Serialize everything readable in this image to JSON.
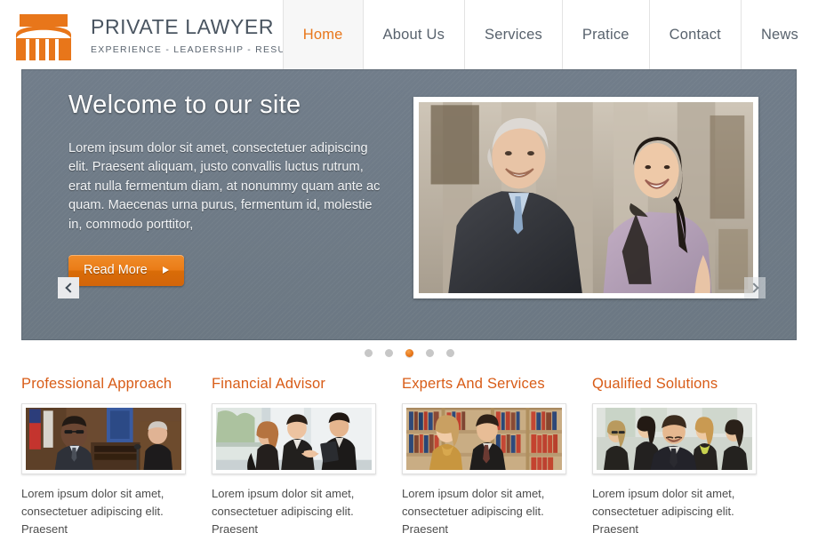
{
  "header": {
    "logo_icon": "courthouse-icon",
    "brand_title": "PRIVATE LAWYER",
    "brand_tagline": "EXPERIENCE  -  LEADERSHIP  -  RESULTS",
    "brand_color": "#e8761a",
    "title_color": "#4a5561",
    "nav": [
      {
        "label": "Home",
        "active": true
      },
      {
        "label": "About Us",
        "active": false
      },
      {
        "label": "Services",
        "active": false
      },
      {
        "label": "Pratice",
        "active": false
      },
      {
        "label": "Contact",
        "active": false
      },
      {
        "label": "News",
        "active": false
      }
    ]
  },
  "hero": {
    "title": "Welcome to our site",
    "body": "Lorem ipsum dolor sit amet, consectetuer adipiscing elit. Praesent aliquam, justo convallis luctus rutrum, erat nulla fermentum diam, at nonummy quam ante ac quam. Maecenas urna purus, fermentum id, molestie in, commodo porttitor,",
    "read_more_label": "Read More",
    "read_more_arrow": "play-arrow-icon",
    "prev_icon": "chevron-left-icon",
    "next_icon": "chevron-right-icon",
    "background_color": "#6c7883",
    "image_alt": "Smiling businessman in dark suit and woman in lavender blouse walking down courthouse steps with columns behind them",
    "slides_total": 5,
    "slide_active_index": 3,
    "accent_color": "#e8761a"
  },
  "cards": [
    {
      "title": "Professional Approach",
      "text": "Lorem ipsum dolor sit amet, consectetuer adipiscing elit. Praesent",
      "image_alt": "Courtroom scene: attorney in dark suit and glasses addressing a judge in black robes, American flag behind"
    },
    {
      "title": "Financial Advisor",
      "text": "Lorem ipsum dolor sit amet, consectetuer adipiscing elit. Praesent",
      "image_alt": "Three colleagues shaking hands in a bright glass-walled office lobby, one holding a folder"
    },
    {
      "title": "Experts And Services",
      "text": "Lorem ipsum dolor sit amet, consectetuer adipiscing elit. Praesent",
      "image_alt": "Woman in gold blouse and man in dark suit seated in a law library with shelves of red and blue legal volumes"
    },
    {
      "title": "Qualified Solutions",
      "text": "Lorem ipsum dolor sit amet, consectetuer adipiscing elit. Praesent",
      "image_alt": "Team group portrait: man in dark suit in front with four women in business attire behind him"
    }
  ]
}
